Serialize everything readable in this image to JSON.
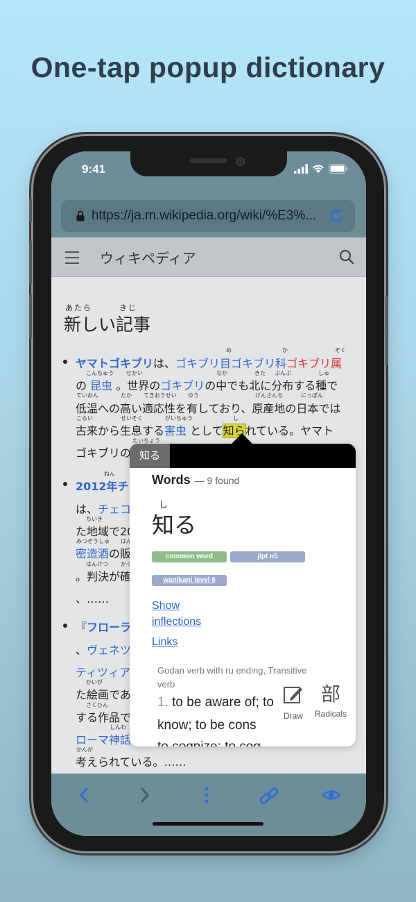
{
  "headline": "One-tap popup dictionary",
  "status": {
    "time": "9:41"
  },
  "browser": {
    "url": "https://ja.m.wikipedia.org/wiki/%E3%..."
  },
  "wiki": {
    "site_title": "ウィキペディア",
    "section_title": "新しい記事",
    "section_ruby": "あたら　　　きじ"
  },
  "article": {
    "p1": {
      "l1": {
        "a": "ヤマトゴキブリ",
        "b": "は、",
        "c": "ゴキブリ目",
        "d": "ゴキブリ科",
        "e": "ゴキブリ属"
      },
      "l1_ruby": [
        "め",
        "か",
        "ぞく"
      ],
      "l2": {
        "a": "の ",
        "b": "昆虫",
        "c": " 。世界の",
        "d": "ゴキブリ",
        "e": "の中でも北に分布する種で"
      },
      "l2_ruby": [
        "こんちゅう",
        "せかい",
        "なか",
        "きた",
        "ぶんぷ",
        "しゅ"
      ],
      "l3": "低温への高い適応性を有しており、原産地の日本では",
      "l3_ruby": [
        "ていおん",
        "たか",
        "てきおうせい",
        "ゆう",
        "げんさんち",
        "にっぽん"
      ],
      "l4": {
        "a": "古来から生息する",
        "b": "害虫",
        "c": " として",
        "d": "知ら",
        "e": "れている。ヤマト"
      },
      "l4_ruby": [
        "こらい",
        "せいそく",
        "がいちゅう",
        "し"
      ],
      "l5": "ゴキブリの",
      "l5_ruby": [
        "たいちょう"
      ]
    },
    "p2": {
      "l1": "2012年チ",
      "l1_ruby": [
        "ねん"
      ],
      "l2a": "は、",
      "l2b": "チェコ",
      "l3": "た地域で20",
      "l3_ruby": [
        "ちいき"
      ],
      "l4": "密造酒",
      "l4b": "の販",
      "l4_ruby": [
        "みつぞうしゅ",
        "はん"
      ],
      "l5": "。判決が確",
      "l5_ruby": [
        "はんけつ",
        "かく"
      ],
      "l6": "、……"
    },
    "p3": {
      "l1a": "『",
      "l1b": "フローラ",
      "l2a": "、",
      "l2b": "ヴェネツ",
      "l3": "ティツィア",
      "l4": "た絵画であ",
      "l4_ruby": [
        "かいが"
      ],
      "l5": "する作品で",
      "l5_ruby": [
        "さくひん"
      ],
      "l6": "ローマ神話",
      "l6_ruby": [
        "しんわ"
      ],
      "l7": "考えられている。……",
      "l7_ruby": [
        "かんが"
      ]
    }
  },
  "popup": {
    "tab": "知る",
    "heading": "Words",
    "found": "— 9 found",
    "reading": "し",
    "headword": "知る",
    "tags": [
      "common word",
      "jlpt n5",
      "wanikani level 6"
    ],
    "show": "Show",
    "inflections": "inflections",
    "links": "Links",
    "pos": "Godan verb with ru ending, Transitive verb",
    "sense_num": "1.",
    "sense1": "to be aware of; to",
    "sense2": "know; to be cons",
    "sense3": "to cognize; to cog",
    "draw_label": "Draw",
    "radicals_glyph": "部",
    "radicals_label": "Radicals"
  },
  "colors": {
    "link": "#3366cc",
    "redlink": "#dd3333",
    "tag_green": "#8dbe8a",
    "tag_blue": "#9aa8cc",
    "toolbar": "#6d8d98",
    "accent": "#2f6fd6"
  }
}
